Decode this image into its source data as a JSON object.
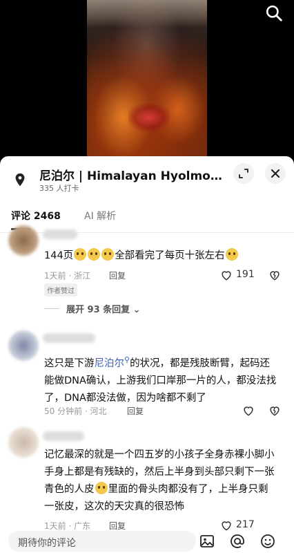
{
  "location": {
    "title": "尼泊尔 | Himalayan Hyolmo Rest...",
    "checkins": "335 人打卡"
  },
  "tabs": [
    {
      "label": "评论 2468",
      "active": true
    },
    {
      "label": "AI 解析",
      "active": false
    }
  ],
  "comments": [
    {
      "text_a": "144页",
      "text_b": "全部看完了每页十张左右",
      "time_loc": "1天前 · 浙江",
      "reply": "回复",
      "badge": "作者赞过",
      "likes": "191",
      "expand": "展开 93 条回复"
    },
    {
      "text_a": "这只是下游",
      "link": "尼泊尔",
      "text_b": "的状况，都是残肢断臂，起码还能做DNA确认，上游我们口岸那一片的人，都没法找了，DNA都没法做，因为啥都不剩了",
      "time_loc": "50 分钟前 · 河北",
      "reply": "回复"
    },
    {
      "text_a": "记忆最深的就是一个四五岁的小孩子全身赤裸小脚小手身上都是有残缺的，然后上半身到头部只剩下一张青色的人皮",
      "text_b": "里面的骨头肉都没有了，上半身只剩一张皮，这次的天灾真的很恐怖",
      "time_loc": "1天前 · 广东",
      "reply": "回复",
      "likes": "217"
    }
  ],
  "input": {
    "placeholder": "期待你的评论"
  },
  "icons": [
    "search-icon",
    "location-pin-icon",
    "expand-icon",
    "close-icon",
    "heart-icon",
    "broken-heart-icon",
    "image-icon",
    "at-icon",
    "emoji-icon"
  ]
}
